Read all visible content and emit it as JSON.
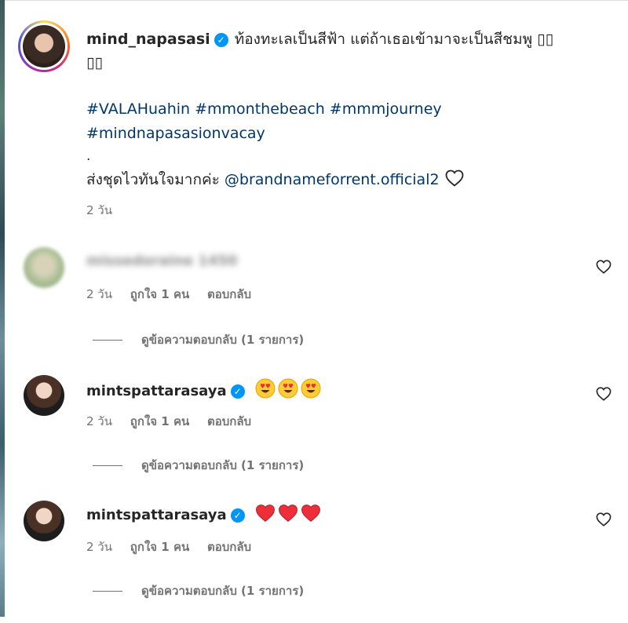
{
  "post": {
    "username": "mind_napasasi",
    "caption_line1": "ท้องทะเลเป็นสีฟ้า แต่ถ้าเธอเข้ามาจะเป็นสีชมพู ▯▯",
    "caption_line2": "▯▯",
    "hashtags_line1": "#VALAHuahin #mmonthebeach #mmmjourney",
    "hashtags_line2": "#mindnapasasionvacay",
    "dot": ".",
    "credit_text": "ส่งชุดไวทันใจมากค่ะ ",
    "mention": "@brandnameforrent.official2",
    "time": "2 วัน"
  },
  "comments": [
    {
      "username": "missedoraine 1450",
      "username_blurred": true,
      "time": "2 วัน",
      "likes": "ถูกใจ 1 คน",
      "reply": "ตอบกลับ",
      "view_replies": "ดูข้อความตอบกลับ (1 รายการ)"
    },
    {
      "username": "mintspattarasaya",
      "emojis": "heart-eyes-emoji x3",
      "time": "2 วัน",
      "likes": "ถูกใจ 1 คน",
      "reply": "ตอบกลับ",
      "view_replies": "ดูข้อความตอบกลับ (1 รายการ)"
    },
    {
      "username": "mintspattarasaya",
      "emojis": "red-heart-emoji x3",
      "time": "2 วัน",
      "likes": "ถูกใจ 1 คน",
      "reply": "ตอบกลับ",
      "view_replies": "ดูข้อความตอบกลับ (1 รายการ)"
    }
  ],
  "colors": {
    "link": "#00376b",
    "verified": "#0095f6",
    "muted": "#737373",
    "heart_red": "#ed2f3a"
  },
  "icons": {
    "verified": "verified-badge-icon",
    "like": "heart-outline-icon"
  }
}
